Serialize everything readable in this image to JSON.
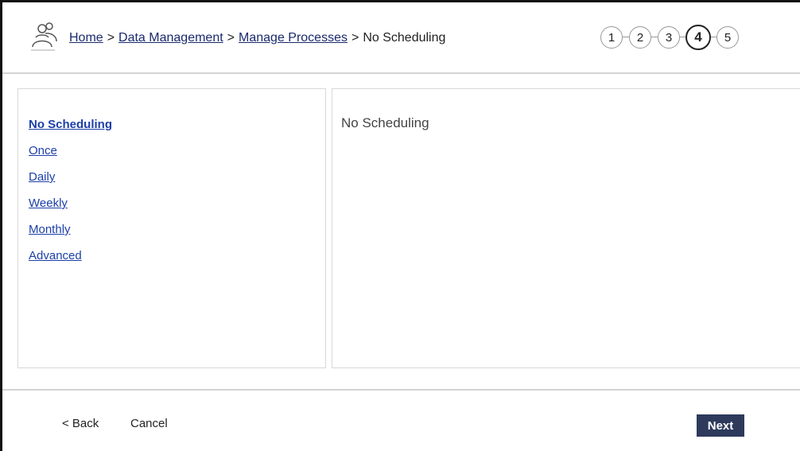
{
  "header": {
    "icon": "users-icon",
    "breadcrumb": {
      "home": "Home",
      "data_management": "Data Management",
      "manage_processes": "Manage Processes",
      "current": "No Scheduling",
      "separator": ">"
    },
    "steps": [
      "1",
      "2",
      "3",
      "4",
      "5"
    ],
    "active_step": "4"
  },
  "schedule_options": [
    "No Scheduling",
    "Once",
    "Daily",
    "Weekly",
    "Monthly",
    "Advanced"
  ],
  "selected_option": "No Scheduling",
  "content": {
    "title": "No Scheduling"
  },
  "footer": {
    "back_label": "< Back",
    "cancel_label": "Cancel",
    "next_label": "Next"
  },
  "colors": {
    "link": "#1c3fa8",
    "next_button_bg": "#2d3a5c",
    "border": "#d8d8d8"
  }
}
